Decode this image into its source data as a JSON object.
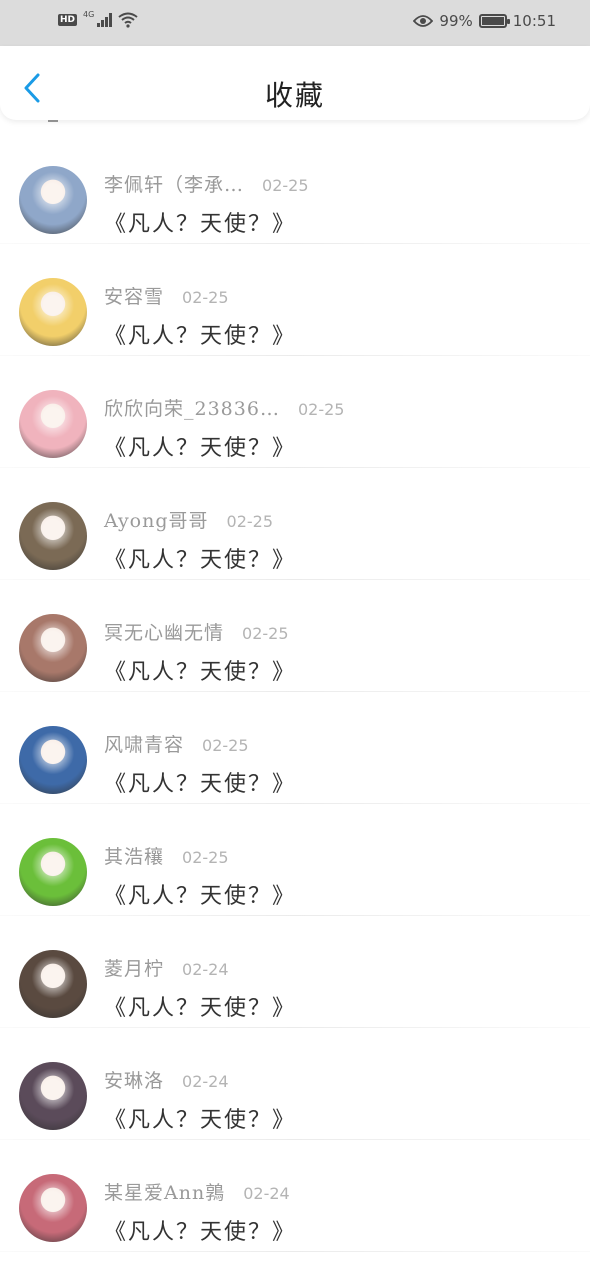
{
  "status_bar": {
    "left_badge": "HD",
    "network": "4G",
    "battery": "99%",
    "battery_level": 0.99,
    "time": "10:51"
  },
  "header": {
    "title": "收藏",
    "back_icon": "chevron-left-icon"
  },
  "colors": {
    "accent": "#1a9be6",
    "status_bg": "#dcdcdc"
  },
  "items": [
    {
      "name": "李佩轩（李承…",
      "date": "02-25",
      "title": "《凡人？天使？》",
      "avatar_color": "#8fa7c9"
    },
    {
      "name": "安容雪",
      "date": "02-25",
      "title": "《凡人？天使？》",
      "avatar_color": "#f2cf6a"
    },
    {
      "name": "欣欣向荣_23836…",
      "date": "02-25",
      "title": "《凡人？天使？》",
      "avatar_color": "#f0b3bd"
    },
    {
      "name": "Ayong哥哥",
      "date": "02-25",
      "title": "《凡人？天使？》",
      "avatar_color": "#7b6a55"
    },
    {
      "name": "冥无心幽无情",
      "date": "02-25",
      "title": "《凡人？天使？》",
      "avatar_color": "#a8786a"
    },
    {
      "name": "风啸青容",
      "date": "02-25",
      "title": "《凡人？天使？》",
      "avatar_color": "#3e6aa8"
    },
    {
      "name": "其浩穰",
      "date": "02-25",
      "title": "《凡人？天使？》",
      "avatar_color": "#6bbf3a"
    },
    {
      "name": "菱月柠",
      "date": "02-24",
      "title": "《凡人？天使？》",
      "avatar_color": "#5a4a40"
    },
    {
      "name": "安琳洛",
      "date": "02-24",
      "title": "《凡人？天使？》",
      "avatar_color": "#5b4b5a"
    },
    {
      "name": "某星爱Ann鶉",
      "date": "02-24",
      "title": "《凡人？天使？》",
      "avatar_color": "#c76a78"
    }
  ]
}
